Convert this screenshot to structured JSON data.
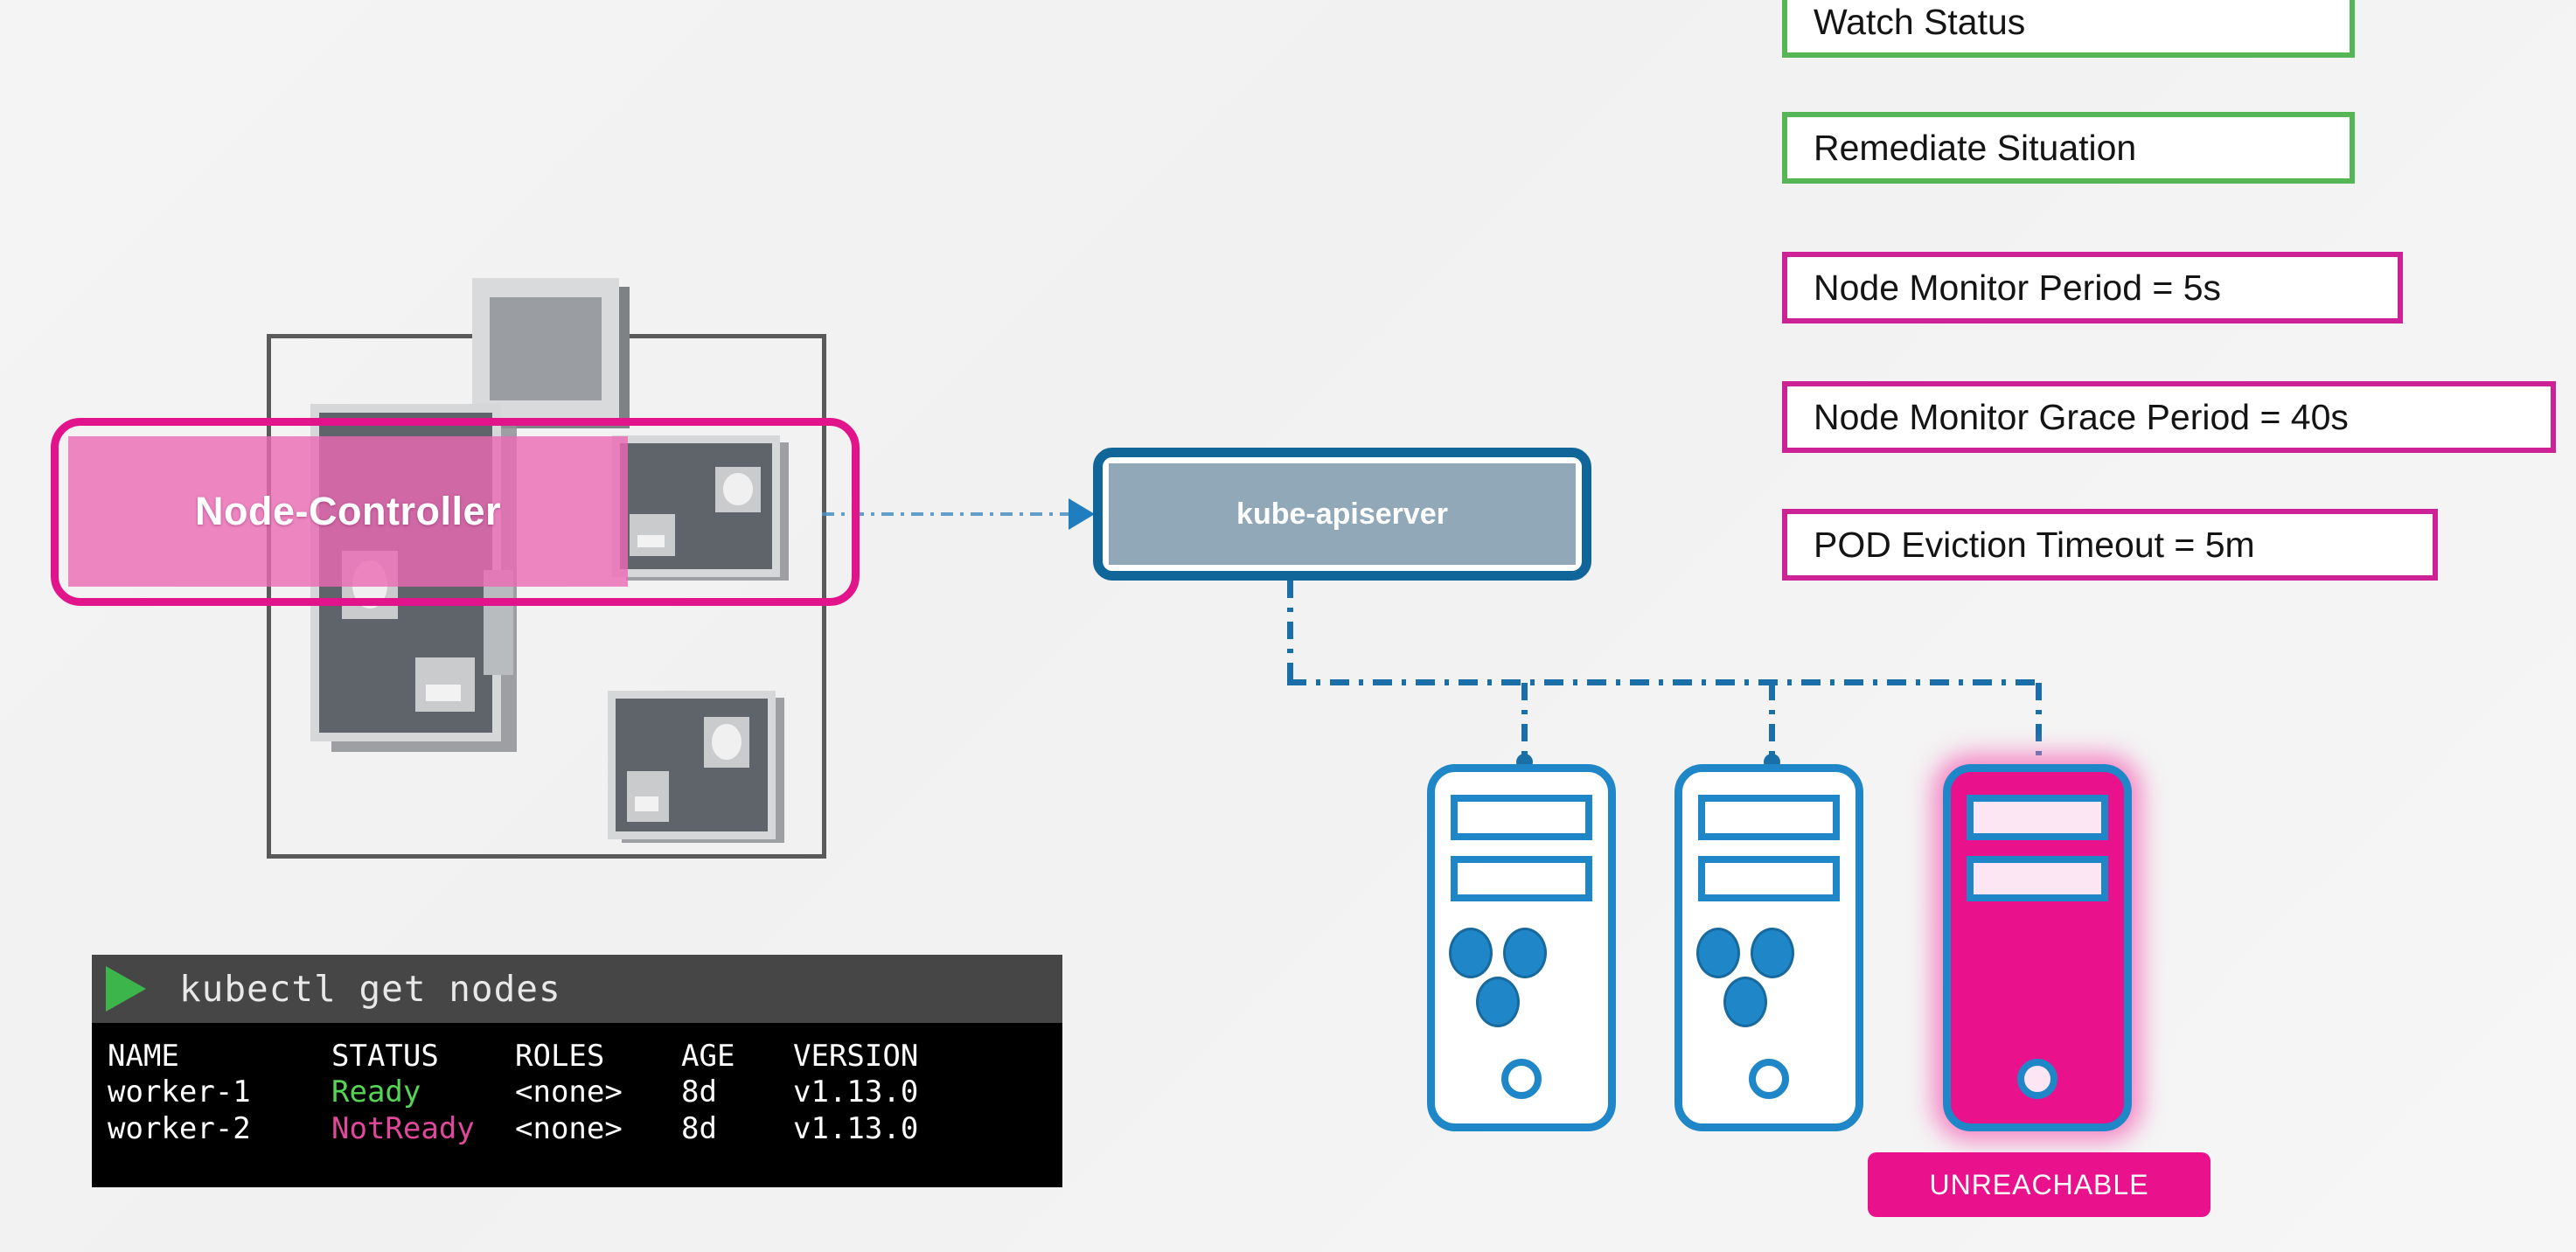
{
  "control_plane": {
    "node_controller_label": "Node-Controller"
  },
  "api": {
    "label": "kube-apiserver"
  },
  "nodes": {
    "unreachable_badge": "UNREACHABLE"
  },
  "info_boxes": [
    {
      "label": "Watch Status",
      "accent": "#55b656"
    },
    {
      "label": "Remediate Situation",
      "accent": "#55b656"
    },
    {
      "label": "Node Monitor Period = 5s",
      "accent": "#cc2296"
    },
    {
      "label": "Node Monitor Grace Period = 40s",
      "accent": "#cc2296"
    },
    {
      "label": "POD Eviction Timeout = 5m",
      "accent": "#cc2296"
    }
  ],
  "terminal": {
    "command": "kubectl get nodes",
    "columns": [
      "NAME",
      "STATUS",
      "ROLES",
      "AGE",
      "VERSION"
    ],
    "rows": [
      {
        "name": "worker-1",
        "status": "Ready",
        "roles": "<none>",
        "age": "8d",
        "version": "v1.13.0"
      },
      {
        "name": "worker-2",
        "status": "NotReady",
        "roles": "<none>",
        "age": "8d",
        "version": "v1.13.0"
      }
    ],
    "status_colors": {
      "ready": "#55d455",
      "notready": "#e0489c"
    }
  },
  "colors": {
    "magenta": "#e2148c",
    "pink_highlight": "#eb69b4",
    "blue": "#1f86c8",
    "api_border": "#116699",
    "green": "#55b656",
    "background": "#f2f2f2"
  }
}
